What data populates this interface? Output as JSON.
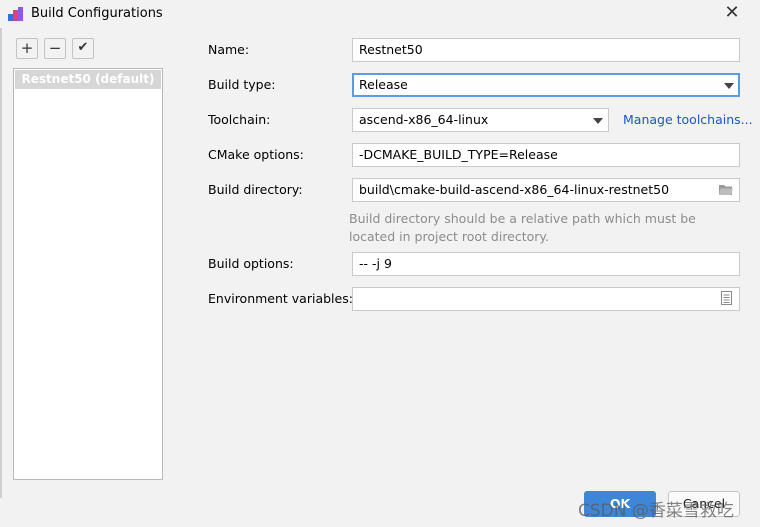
{
  "window": {
    "title": "Build Configurations",
    "close_glyph": "✕"
  },
  "toolbar": {
    "add_glyph": "+",
    "remove_glyph": "−",
    "apply_glyph": "✔"
  },
  "config_list": {
    "items": [
      {
        "label": "Restnet50 (default)"
      }
    ]
  },
  "form": {
    "name": {
      "label": "Name:",
      "value": "Restnet50"
    },
    "build_type": {
      "label": "Build type:",
      "value": "Release"
    },
    "toolchain": {
      "label": "Toolchain:",
      "value": "ascend-x86_64-linux",
      "link": "Manage toolchains..."
    },
    "cmake_options": {
      "label": "CMake options:",
      "value": "-DCMAKE_BUILD_TYPE=Release"
    },
    "build_directory": {
      "label": "Build directory:",
      "value": "build\\cmake-build-ascend-x86_64-linux-restnet50",
      "hint_line1": "Build directory should be a relative path which must be",
      "hint_line2": "located in project root directory."
    },
    "build_options": {
      "label": "Build options:",
      "value": "-- -j 9"
    },
    "environment_variables": {
      "label": "Environment variables:",
      "value": ""
    }
  },
  "footer": {
    "ok_label": "OK",
    "cancel_label": "Cancel"
  },
  "watermark": {
    "text": "CSDN @香菜雪救吃"
  },
  "colors": {
    "accent": "#3d86d8",
    "link": "#1a55c9",
    "focus": "#5b9be0",
    "hint": "#8c8c8c"
  }
}
